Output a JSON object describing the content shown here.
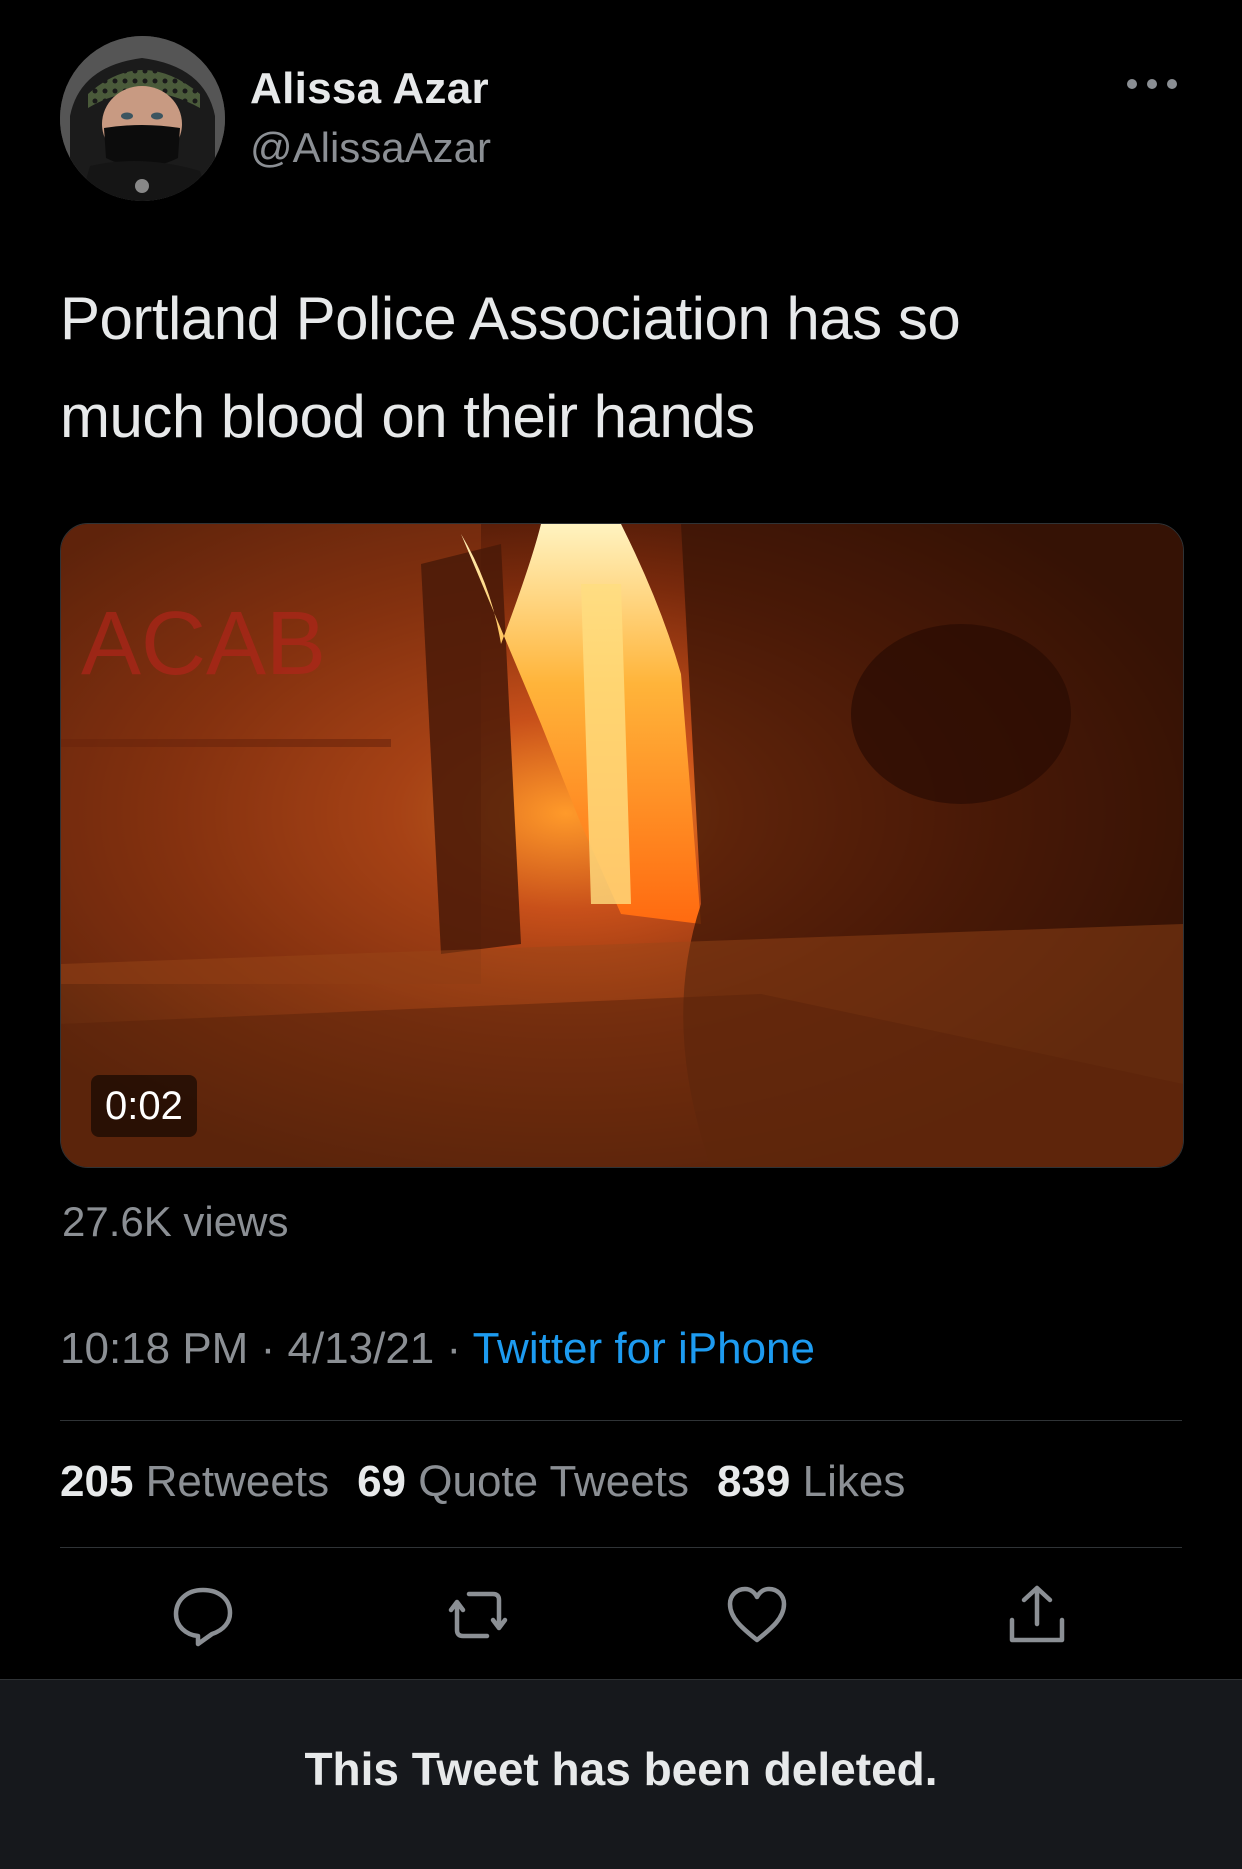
{
  "tweet": {
    "author_name": "Alissa Azar",
    "author_handle": "@AlissaAzar",
    "text_line1": "Portland Police Association has so",
    "text_line2": "much blood on their hands",
    "video_duration": "0:02",
    "views": "27.6K views",
    "time": "10:18 PM",
    "separator": "·",
    "date": "4/13/21",
    "source": "Twitter for iPhone",
    "retweets_count": "205",
    "retweets_label": "Retweets",
    "quote_count": "69",
    "quote_label": "Quote Tweets",
    "likes_count": "839",
    "likes_label": "Likes"
  },
  "footer": {
    "deleted_message": "This Tweet has been deleted."
  },
  "icons": {
    "more": "more-options-icon",
    "reply": "reply-icon",
    "retweet": "retweet-icon",
    "like": "heart-icon",
    "share": "share-icon"
  },
  "colors": {
    "background": "#000000",
    "link": "#1d9bf0",
    "secondary_text": "#8b8f94",
    "footer_bg": "#16181c"
  }
}
